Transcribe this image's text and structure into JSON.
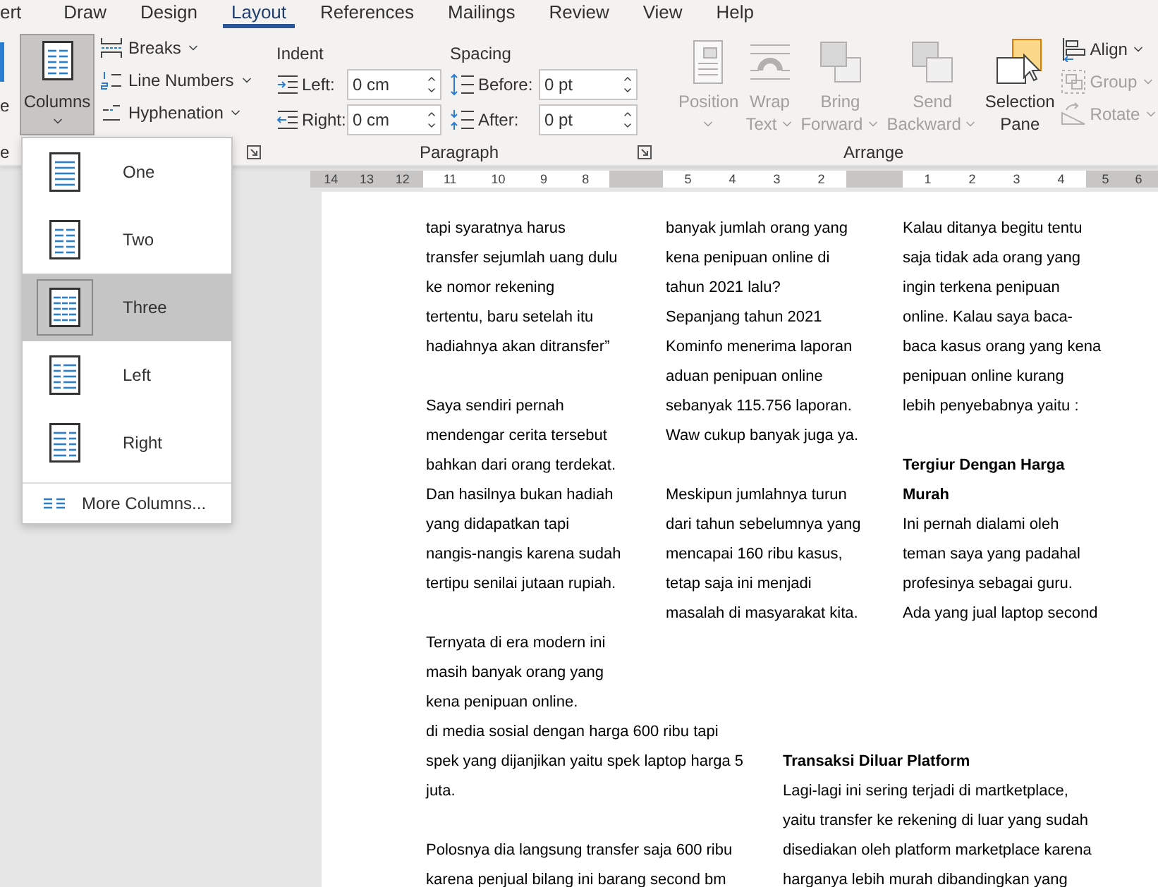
{
  "tabs": [
    {
      "label": "ert",
      "selected": false
    },
    {
      "label": "Draw",
      "selected": false
    },
    {
      "label": "Design",
      "selected": false
    },
    {
      "label": "Layout",
      "selected": true
    },
    {
      "label": "References",
      "selected": false
    },
    {
      "label": "Mailings",
      "selected": false
    },
    {
      "label": "Review",
      "selected": false
    },
    {
      "label": "View",
      "selected": false
    },
    {
      "label": "Help",
      "selected": false
    }
  ],
  "page_setup": {
    "cut_label": "e",
    "group_label": "e",
    "columns_button": {
      "label": "Columns",
      "expanded": true
    },
    "small_buttons": [
      {
        "kind": "breaks",
        "label": "Breaks"
      },
      {
        "kind": "numbers",
        "label": "Line Numbers"
      },
      {
        "kind": "hyphen",
        "label": "Hyphenation"
      }
    ]
  },
  "paragraph": {
    "indent_label": "Indent",
    "spacing_label": "Spacing",
    "indent": [
      {
        "kind": "left",
        "label": "Left:",
        "value": "0 cm"
      },
      {
        "kind": "right",
        "label": "Right:",
        "value": "0 cm"
      }
    ],
    "spacing": [
      {
        "kind": "before",
        "label": "Before:",
        "value": "0 pt"
      },
      {
        "kind": "after",
        "label": "After:",
        "value": "0 pt"
      }
    ],
    "group_label": "Paragraph"
  },
  "arrange": {
    "buttons": [
      {
        "kind": "position",
        "lines": [
          "Position"
        ],
        "disabled": true
      },
      {
        "kind": "wrap",
        "lines": [
          "Wrap",
          "Text"
        ],
        "disabled": true
      },
      {
        "kind": "forward",
        "lines": [
          "Bring",
          "Forward"
        ],
        "disabled": true
      },
      {
        "kind": "backward",
        "lines": [
          "Send",
          "Backward"
        ],
        "disabled": true
      },
      {
        "kind": "pane",
        "lines": [
          "Selection",
          "Pane"
        ],
        "disabled": false
      }
    ],
    "small_buttons": [
      {
        "kind": "align",
        "label": "Align",
        "disabled": false
      },
      {
        "kind": "group",
        "label": "Group",
        "disabled": true
      },
      {
        "kind": "rotate",
        "label": "Rotate",
        "disabled": true
      }
    ],
    "group_label": "Arrange"
  },
  "ruler": [
    {
      "shaded": true,
      "labels": [
        "14",
        "13",
        "12"
      ]
    },
    {
      "shaded": false,
      "labels": [
        "11",
        "10",
        "9",
        "8"
      ]
    },
    {
      "shaded": true
    },
    {
      "shaded": false,
      "labels": [
        "5",
        "4",
        "3",
        "2"
      ]
    },
    {
      "shaded": true
    },
    {
      "shaded": false,
      "labels": [
        "1",
        "2",
        "3",
        "4"
      ]
    },
    {
      "shaded": true,
      "labels": [
        "5",
        "6"
      ]
    }
  ],
  "columns_menu": {
    "options": [
      {
        "kind": "one",
        "label": "One",
        "selected": false
      },
      {
        "kind": "two",
        "label": "Two",
        "selected": false
      },
      {
        "kind": "three",
        "label": "Three",
        "selected": true
      },
      {
        "kind": "left",
        "label": "Left",
        "selected": false
      },
      {
        "kind": "right",
        "label": "Right",
        "selected": false
      }
    ],
    "more": "More Columns..."
  },
  "document": {
    "top_columns": [
      [
        {
          "kind": "para",
          "lines": [
            "tapi syaratnya harus",
            "transfer sejumlah uang dulu",
            "ke nomor rekening",
            "tertentu, baru setelah itu",
            "hadiahnya akan ditransfer”"
          ]
        },
        {
          "kind": "para",
          "lines": [
            "Saya sendiri pernah",
            "mendengar cerita tersebut",
            "bahkan dari orang terdekat.",
            "Dan hasilnya bukan hadiah",
            "yang didapatkan tapi",
            "nangis-nangis karena sudah",
            "tertipu senilai jutaan rupiah."
          ]
        },
        {
          "kind": "para",
          "lines": [
            "Ternyata di era modern ini",
            "masih banyak orang yang",
            "kena penipuan online."
          ]
        }
      ],
      [
        {
          "kind": "para",
          "lines": [
            "banyak jumlah orang yang",
            "kena penipuan online di",
            "tahun 2021 lalu?",
            "Sepanjang tahun 2021",
            "Kominfo menerima laporan",
            "aduan penipuan online",
            "sebanyak 115.756 laporan.",
            "Waw cukup banyak juga ya."
          ]
        },
        {
          "kind": "para",
          "lines": [
            "Meskipun jumlahnya turun",
            "dari tahun sebelumnya yang",
            "mencapai 160 ribu kasus,",
            "tetap saja ini menjadi",
            "masalah di masyarakat kita."
          ]
        }
      ],
      [
        {
          "kind": "para",
          "lines": [
            "Kalau ditanya begitu tentu",
            "saja tidak ada orang yang",
            "ingin terkena penipuan",
            "online. Kalau saya baca-",
            "baca kasus orang yang kena",
            "penipuan online kurang",
            "lebih penyebabnya yaitu :"
          ]
        },
        {
          "kind": "heading",
          "lines": [
            "Tergiur Dengan Harga",
            "Murah"
          ]
        },
        {
          "kind": "para",
          "lines": [
            "Ini pernah dialami oleh",
            "teman saya yang padahal",
            "profesinya sebagai guru.",
            "Ada yang jual laptop second"
          ]
        }
      ]
    ],
    "bottom_columns": [
      [
        {
          "kind": "para",
          "lines": [
            "di media sosial dengan harga 600 ribu tapi",
            "spek yang dijanjikan yaitu spek laptop harga 5",
            "juta."
          ]
        },
        {
          "kind": "para",
          "lines": [
            "Polosnya dia langsung transfer saja 600 ribu",
            "karena penjual bilang ini barang second bm"
          ]
        }
      ],
      [
        {
          "kind": "heading",
          "lines": [
            "Transaksi Diluar Platform"
          ]
        },
        {
          "kind": "para",
          "lines": [
            "Lagi-lagi ini sering terjadi di martketplace,",
            "yaitu transfer ke rekening di luar yang sudah",
            "disediakan oleh platform marketplace karena",
            "harganya lebih murah dibandingkan yang"
          ]
        }
      ]
    ]
  }
}
